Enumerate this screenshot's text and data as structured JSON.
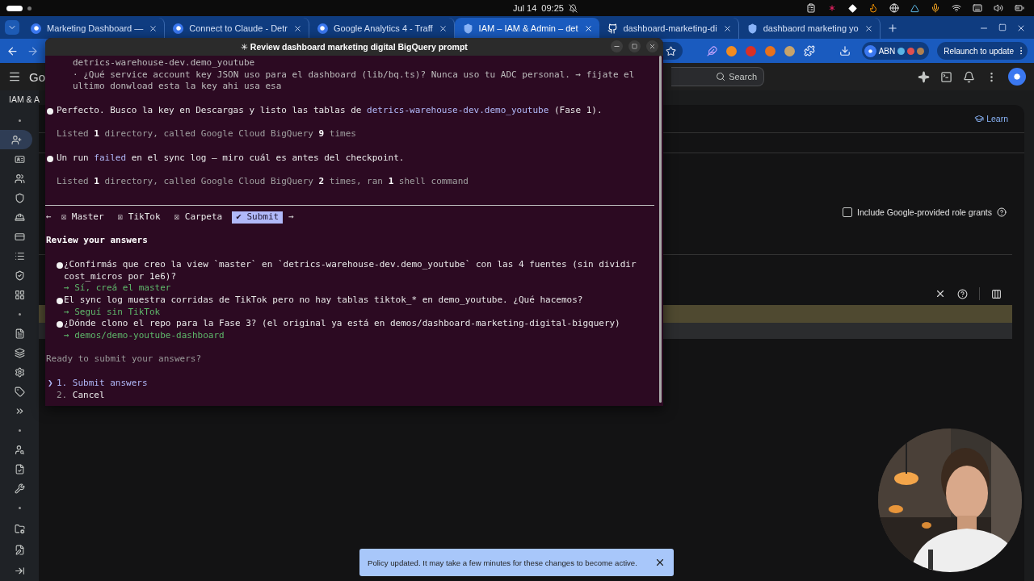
{
  "topbar": {
    "date": "Jul 14",
    "time": "09:25"
  },
  "browser": {
    "tabs": [
      {
        "title": "Marketing Dashboard —",
        "selected": false
      },
      {
        "title": "Connect to Claude - Detr",
        "selected": false
      },
      {
        "title": "Google Analytics 4 - Traff",
        "selected": false
      },
      {
        "title": "IAM – IAM & Admin – det",
        "selected": true
      },
      {
        "title": "dashboard-marketing-di",
        "selected": false
      },
      {
        "title": "dashbaord marketing yo",
        "selected": false
      }
    ],
    "profile": "ABN",
    "relaunch": "Relaunch to update"
  },
  "console": {
    "nav_items": [
      {
        "selected": true
      },
      {
        "selected": false
      },
      {
        "selected": false
      },
      {
        "selected": false
      },
      {
        "selected": false
      },
      {
        "selected": false
      },
      {
        "selected": false
      },
      {
        "selected": false
      },
      {
        "selected": false
      },
      {
        "selected": false
      },
      {
        "selected": false
      },
      {
        "selected": false
      },
      {
        "selected": false
      },
      {
        "selected": false
      },
      {
        "selected": false
      },
      {
        "selected": false
      },
      {
        "selected": false
      },
      {
        "selected": false
      },
      {
        "selected": false
      },
      {
        "selected": false
      }
    ],
    "product": "Go",
    "section": "IAM & A",
    "search": "Search",
    "learn": "Learn",
    "include_grants": {
      "label": "Include Google-provided role grants",
      "checked": false
    }
  },
  "terminal": {
    "title": "✳ Review dashboard marketing digital BigQuery prompt",
    "context_lines": [
      "detrics-warehouse-dev.demo_youtube",
      "· ¿Qué service account key JSON uso para el dashboard (lib/bq.ts)? Nunca uso tu ADC personal. → fijate el",
      "ultimo donwload esta la key ahi usa esa"
    ],
    "messages": [
      {
        "kind": "assistant",
        "segments": [
          {
            "text": "Perfecto. Busco la key en Descargas y listo las tablas de ",
            "highlight": false
          },
          {
            "text": "detrics-warehouse-dev.demo_youtube",
            "highlight": true
          },
          {
            "text": " (Fase 1).",
            "highlight": false
          }
        ]
      },
      {
        "kind": "tool",
        "text": "Listed **1** directory, called Google Cloud BigQuery **9** times"
      },
      {
        "kind": "assistant",
        "segments": [
          {
            "text": "Un run ",
            "highlight": false
          },
          {
            "text": "failed",
            "highlight": true
          },
          {
            "text": " en el sync log — miro cuál es antes del checkpoint.",
            "highlight": false
          }
        ]
      },
      {
        "kind": "tool",
        "text": "Listed **1** directory, called Google Cloud BigQuery **2** times, ran **1** shell command"
      }
    ],
    "steps": {
      "back": "←",
      "next": "→",
      "items": [
        {
          "mark": "☒",
          "label": "Master",
          "selected": false
        },
        {
          "mark": "☒",
          "label": "TikTok",
          "selected": false
        },
        {
          "mark": "☒",
          "label": "Carpeta",
          "selected": false
        },
        {
          "mark": "✔",
          "label": "Submit",
          "selected": true
        }
      ]
    },
    "review": {
      "heading": "Review your answers",
      "questions": [
        {
          "question": "¿Confirmás que creo la view `master` en `detrics-warehouse-dev.demo_youtube` con las 4 fuentes (sin dividir cost_micros por 1e6)?",
          "answer": "→ Sí, creá el master"
        },
        {
          "question": "El sync log muestra corridas de TikTok pero no hay tablas tiktok_* en demo_youtube. ¿Qué hacemos?",
          "answer": "→ Seguí sin TikTok"
        },
        {
          "question": "¿Dónde clono el repo para la Fase 3? (el original ya está en demos/dashboard-marketing-digital-bigquery)",
          "answer": "→ demos/demo-youtube-dashboard"
        }
      ],
      "prompt": "Ready to submit your answers?",
      "pointer": "❯",
      "options": [
        {
          "number": "1.",
          "label": "Submit answers",
          "selected": true
        },
        {
          "number": "2.",
          "label": "Cancel",
          "selected": false
        }
      ]
    }
  },
  "toast": {
    "text": "Policy updated. It may take a few minutes for these changes to become active."
  }
}
